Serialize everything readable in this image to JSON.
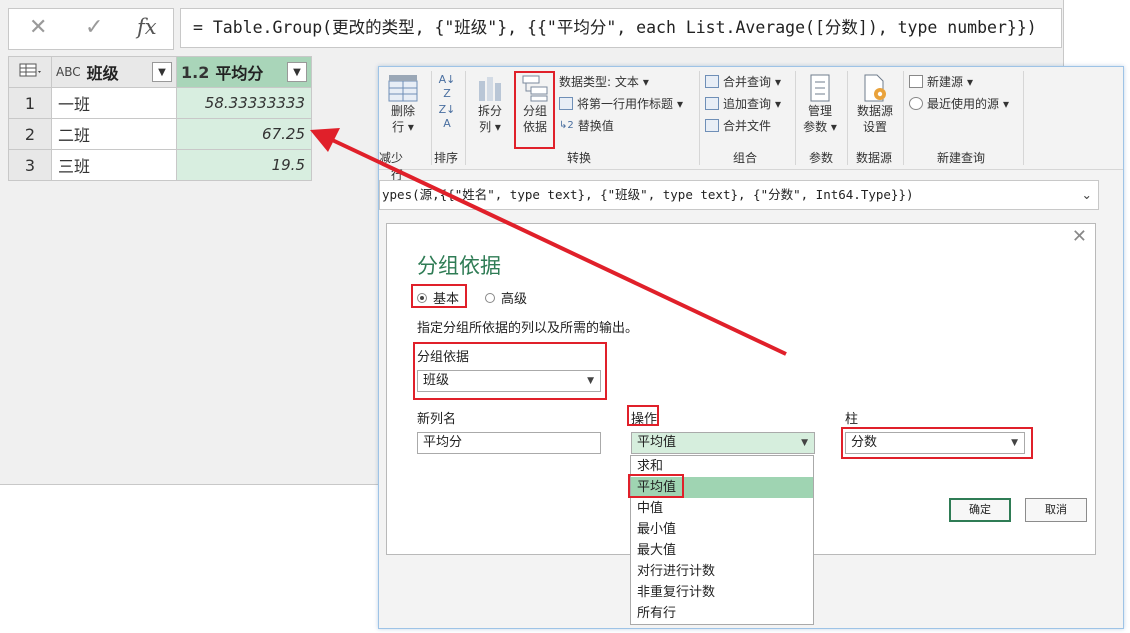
{
  "formula_bar": {
    "cancel_icon": "x-icon",
    "confirm_icon": "check-icon",
    "fx_label": "fx",
    "formula": "= Table.Group(更改的类型, {\"班级\"}, {{\"平均分\", each List.Average([分数]), type number}})"
  },
  "preview_table": {
    "columns": [
      {
        "type_icon": "ABC",
        "name": "班级"
      },
      {
        "type_icon": "1.2",
        "name": "平均分"
      }
    ],
    "rows": [
      {
        "index": "1",
        "class": "一班",
        "avg": "58.33333333"
      },
      {
        "index": "2",
        "class": "二班",
        "avg": "67.25"
      },
      {
        "index": "3",
        "class": "三班",
        "avg": "19.5"
      }
    ]
  },
  "ribbon": {
    "remove_rows": "删除\n行",
    "remove_rows_line1": "删除",
    "remove_rows_line2": "行",
    "split_col_line1": "拆分",
    "split_col_line2": "列",
    "group_by_line1": "分组",
    "group_by_line2": "依据",
    "data_type": "数据类型: 文本",
    "first_row_header": "将第一行用作标题",
    "replace_values": "替换值",
    "merge_queries": "合并查询",
    "append_queries": "追加查询",
    "combine_files": "合并文件",
    "manage_params_line1": "管理",
    "manage_params_line2": "参数",
    "datasource_line1": "数据源",
    "datasource_line2": "设置",
    "new_source": "新建源",
    "recent_sources": "最近使用的源",
    "groups": {
      "rows": "减少行",
      "sort": "排序",
      "transform": "转换",
      "combine": "组合",
      "params": "参数",
      "datasource": "数据源",
      "new_query": "新建查询"
    }
  },
  "formula_bar2": {
    "text": "ypes(源,{{\"姓名\", type text}, {\"班级\", type text}, {\"分数\", Int64.Type}})"
  },
  "dialog": {
    "title": "分组依据",
    "radio_basic": "基本",
    "radio_advanced": "高级",
    "description": "指定分组所依据的列以及所需的输出。",
    "group_by_label": "分组依据",
    "group_by_value": "班级",
    "new_column_label": "新列名",
    "new_column_value": "平均分",
    "operation_label": "操作",
    "operation_value": "平均值",
    "column_label": "柱",
    "column_value": "分数",
    "ok": "确定",
    "cancel": "取消",
    "operation_options": [
      "求和",
      "平均值",
      "中值",
      "最小值",
      "最大值",
      "对行进行计数",
      "非重复行计数",
      "所有行"
    ]
  },
  "colors": {
    "accent_green": "#2f7c55",
    "highlight_red": "#e0202a",
    "selected_green": "#9fd4b2"
  }
}
